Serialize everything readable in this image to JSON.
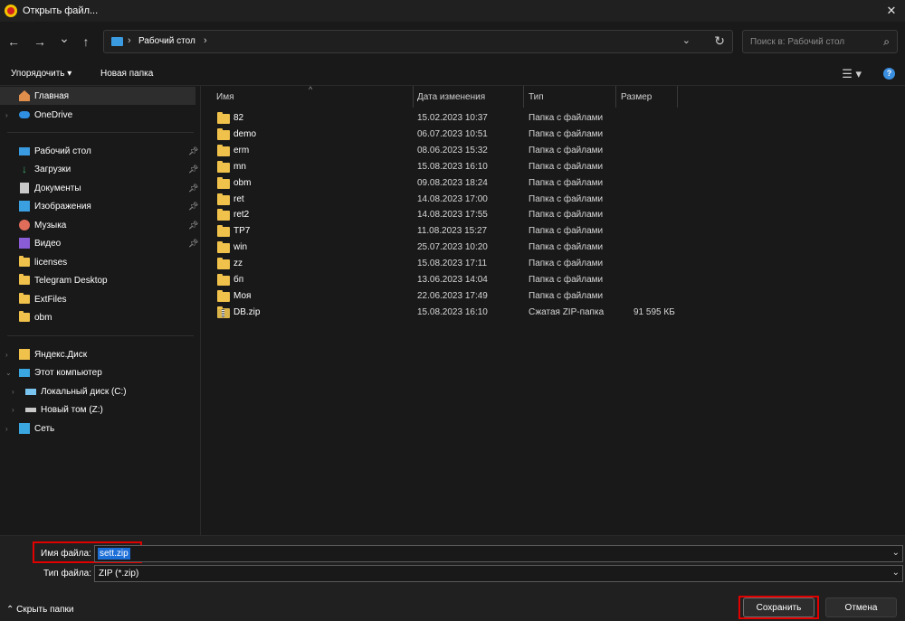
{
  "window": {
    "title": "Открыть файл...",
    "close_glyph": "✕"
  },
  "nav": {
    "back_glyph": "←",
    "forward_glyph": "→",
    "recent_glyph": "⌄",
    "up_glyph": "↑",
    "address": {
      "segment": "Рабочий стол"
    },
    "search_placeholder": "Поиск в: Рабочий стол"
  },
  "toolbar": {
    "organize_label": "Упорядочить ▾",
    "new_folder_label": "Новая папка",
    "help_glyph": "?"
  },
  "sidebar": {
    "items": [
      {
        "label": "Главная",
        "icon": "home-icon",
        "selected": true
      },
      {
        "label": "OneDrive",
        "icon": "cloud-icon",
        "expandable": true
      },
      {
        "label": "Рабочий стол",
        "icon": "desktop-icon",
        "pinned": true
      },
      {
        "label": "Загрузки",
        "icon": "download-icon",
        "pinned": true
      },
      {
        "label": "Документы",
        "icon": "documents-icon",
        "pinned": true
      },
      {
        "label": "Изображения",
        "icon": "pictures-icon",
        "pinned": true
      },
      {
        "label": "Музыка",
        "icon": "music-icon",
        "pinned": true
      },
      {
        "label": "Видео",
        "icon": "video-icon",
        "pinned": true
      },
      {
        "label": "licenses",
        "icon": "folder-icon"
      },
      {
        "label": "Telegram Desktop",
        "icon": "folder-icon"
      },
      {
        "label": "ExtFiles",
        "icon": "folder-icon"
      },
      {
        "label": "obm",
        "icon": "folder-icon"
      },
      {
        "label": "Яндекс.Диск",
        "icon": "yandex-disk-icon",
        "expandable": true
      },
      {
        "label": "Этот компьютер",
        "icon": "computer-icon",
        "expandable": true
      },
      {
        "label": "Локальный диск (C:)",
        "icon": "drive-icon",
        "expandable": true
      },
      {
        "label": "Новый том (Z:)",
        "icon": "drive-icon",
        "expandable": true
      },
      {
        "label": "Сеть",
        "icon": "network-icon",
        "expandable": true
      }
    ]
  },
  "filelist": {
    "columns": {
      "name": "Имя",
      "date": "Дата изменения",
      "type": "Тип",
      "size": "Размер"
    },
    "rows": [
      {
        "name": "82",
        "date": "15.02.2023 10:37",
        "type": "Папка с файлами",
        "size": ""
      },
      {
        "name": "demo",
        "date": "06.07.2023 10:51",
        "type": "Папка с файлами",
        "size": ""
      },
      {
        "name": "erm",
        "date": "08.06.2023 15:32",
        "type": "Папка с файлами",
        "size": ""
      },
      {
        "name": "mn",
        "date": "15.08.2023 16:10",
        "type": "Папка с файлами",
        "size": ""
      },
      {
        "name": "obm",
        "date": "09.08.2023 18:24",
        "type": "Папка с файлами",
        "size": ""
      },
      {
        "name": "ret",
        "date": "14.08.2023 17:00",
        "type": "Папка с файлами",
        "size": ""
      },
      {
        "name": "ret2",
        "date": "14.08.2023 17:55",
        "type": "Папка с файлами",
        "size": ""
      },
      {
        "name": "TP7",
        "date": "11.08.2023 15:27",
        "type": "Папка с файлами",
        "size": ""
      },
      {
        "name": "win",
        "date": "25.07.2023 10:20",
        "type": "Папка с файлами",
        "size": ""
      },
      {
        "name": "zz",
        "date": "15.08.2023 17:11",
        "type": "Папка с файлами",
        "size": ""
      },
      {
        "name": "бп",
        "date": "13.06.2023 14:04",
        "type": "Папка с файлами",
        "size": ""
      },
      {
        "name": "Моя",
        "date": "22.06.2023 17:49",
        "type": "Папка с файлами",
        "size": ""
      },
      {
        "name": "DB.zip",
        "date": "15.08.2023 16:10",
        "type": "Сжатая ZIP-папка",
        "size": "91 595 КБ",
        "zip": true
      }
    ]
  },
  "bottom": {
    "filename_label": "Имя файла:",
    "filename_value": "sett.zip",
    "filetype_label": "Тип файла:",
    "filetype_value": "ZIP (*.zip)",
    "hide_folders_label": "Скрыть папки",
    "save_label": "Сохранить",
    "cancel_label": "Отмена"
  },
  "colors": {
    "accent": "#1d6fd8",
    "highlight_box": "#e00000",
    "folder": "#f0c14b",
    "background": "#191919"
  }
}
